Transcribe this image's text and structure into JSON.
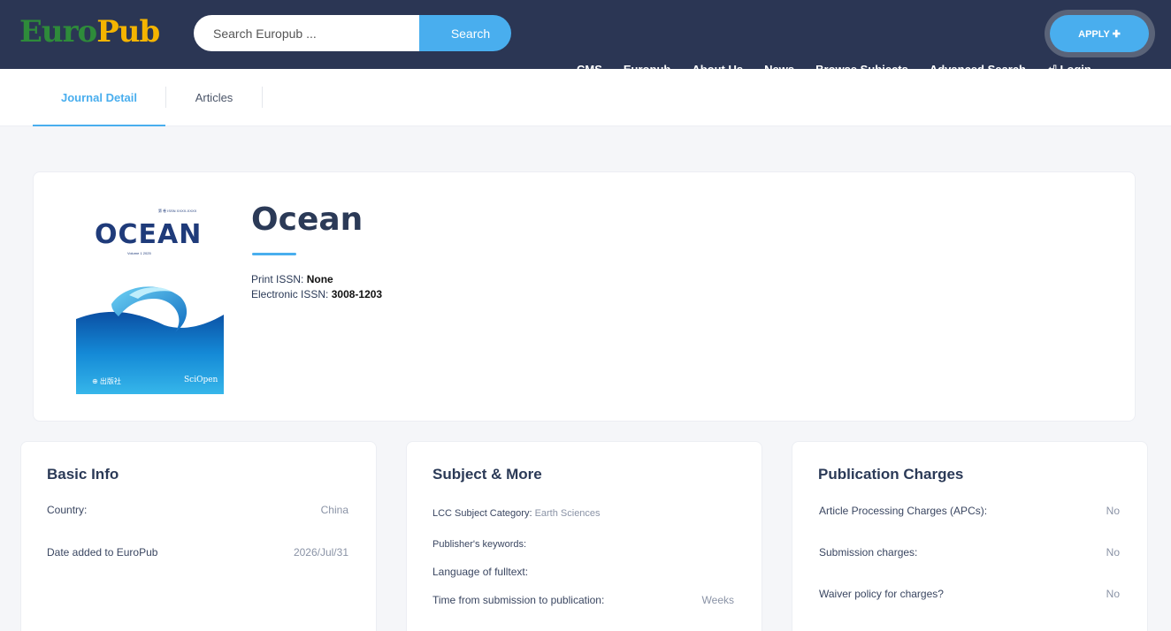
{
  "header": {
    "logo_part1": "Euro",
    "logo_part2": "Pub",
    "search_placeholder": "Search Europub ...",
    "search_button": "Search",
    "apply_button": "APPLY ✚",
    "nav": [
      "CMS",
      "Europub",
      "About Us",
      "News",
      "Browse Subjects",
      "Advanced Search",
      "⏎ Login"
    ]
  },
  "tabs": {
    "detail": "Journal Detail",
    "articles": "Articles"
  },
  "journal": {
    "title": "Ocean",
    "print_issn_label": "Print ISSN:",
    "print_issn_value": "None",
    "electronic_issn_label": "Electronic ISSN:",
    "electronic_issn_value": "3008-1203",
    "cover": {
      "topline": "第 卷 ISSN XXXX-XXXX",
      "title": "OCEAN",
      "volume": "Volume 1  2025",
      "publisher_left": "⊕ 出版社",
      "publisher_right": "SciOpen"
    }
  },
  "basic_info": {
    "title": "Basic Info",
    "rows": [
      {
        "label": "Country:",
        "value": "China"
      },
      {
        "label": "Date added to EuroPub",
        "value": "2026/Jul/31"
      }
    ]
  },
  "subject": {
    "title": "Subject & More",
    "lcc_label": "LCC Subject Category:",
    "lcc_value": "Earth Sciences",
    "keywords_label": "Publisher's keywords:",
    "language_label": "Language of fulltext:",
    "time_label": "Time from submission to publication:",
    "time_value": "Weeks"
  },
  "charges": {
    "title": "Publication Charges",
    "rows": [
      {
        "label": "Article Processing Charges (APCs):",
        "value": "No"
      },
      {
        "label": "Submission charges:",
        "value": "No"
      },
      {
        "label": "Waiver policy for charges?",
        "value": "No"
      }
    ]
  },
  "colors": {
    "header_bg": "#2b3654",
    "accent": "#49aeee",
    "logo_green": "#2e8b3a",
    "logo_yellow": "#f4b400",
    "cover_blue": "#1f3b7a"
  }
}
